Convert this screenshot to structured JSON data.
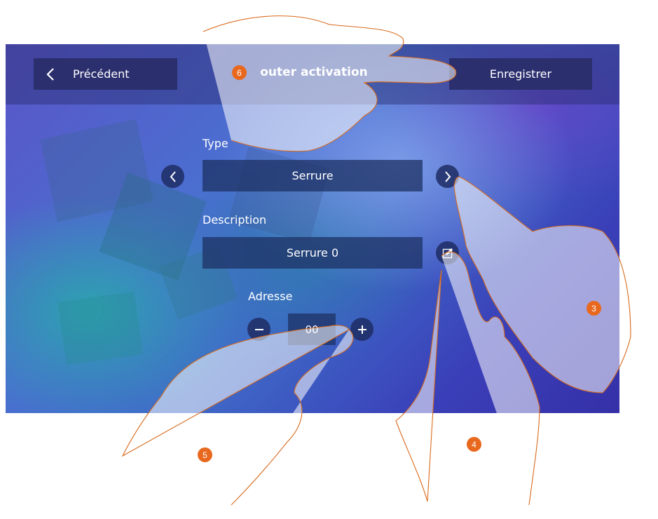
{
  "header": {
    "back_label": "Précédent",
    "title": "outer activation",
    "save_label": "Enregistrer"
  },
  "form": {
    "type_label": "Type",
    "type_value": "Serrure",
    "description_label": "Description",
    "description_value": "Serrure 0",
    "address_label": "Adresse",
    "address_value": "00"
  },
  "callouts": [
    "3",
    "4",
    "5",
    "6"
  ],
  "colors": {
    "accent_badge": "#e8681e",
    "button_bg": "#2c2f6e",
    "hand_outline": "#d86a1c"
  },
  "icons": {
    "back": "chevron-left-icon",
    "prev": "chevron-left-icon",
    "next": "chevron-right-icon",
    "edit": "pencil-icon",
    "minus": "minus-icon",
    "plus": "plus-icon"
  }
}
